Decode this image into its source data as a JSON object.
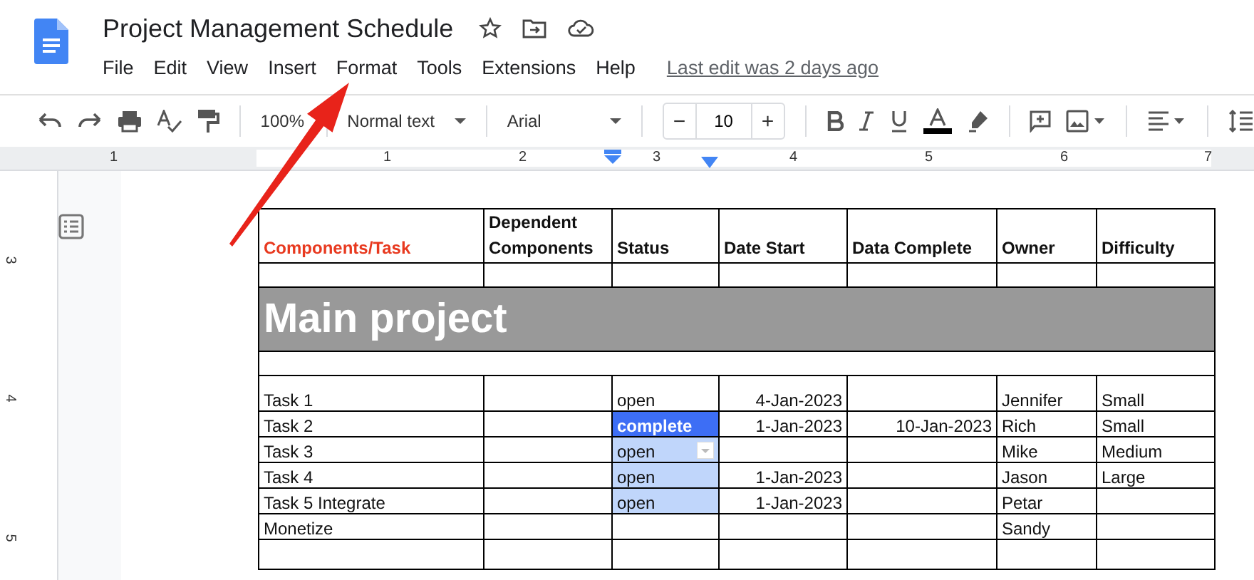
{
  "document": {
    "title": "Project Management Schedule",
    "last_edit": "Last edit was 2 days ago"
  },
  "menu": [
    "File",
    "Edit",
    "View",
    "Insert",
    "Format",
    "Tools",
    "Extensions",
    "Help"
  ],
  "toolbar": {
    "zoom": "100%",
    "style": "Normal text",
    "font": "Arial",
    "font_size": "10",
    "minus": "−",
    "plus": "+"
  },
  "ruler": {
    "top_numbers": [
      "1",
      "1",
      "2",
      "3",
      "4",
      "5",
      "6",
      "7"
    ],
    "side_numbers": [
      "3",
      "4",
      "5"
    ]
  },
  "table": {
    "columns": [
      {
        "label": "Components/Task",
        "accent": true
      },
      {
        "label": "Dependent Components",
        "accent": false
      },
      {
        "label": "Status",
        "accent": false
      },
      {
        "label": "Date Start",
        "accent": false
      },
      {
        "label": "Data Complete",
        "accent": false
      },
      {
        "label": "Owner",
        "accent": false
      },
      {
        "label": "Difficulty",
        "accent": false
      }
    ],
    "banner": "Main project",
    "rows": [
      {
        "task": "Task 1",
        "dependent": "",
        "status": "open",
        "selected": false,
        "highlighted": false,
        "dropdown": false,
        "date_start": "4-Jan-2023",
        "date_complete": "",
        "owner": "Jennifer",
        "difficulty": "Small"
      },
      {
        "task": "Task 2",
        "dependent": "",
        "status": "complete",
        "selected": false,
        "highlighted": true,
        "dropdown": false,
        "date_start": "1-Jan-2023",
        "date_complete": "10-Jan-2023",
        "owner": "Rich",
        "difficulty": "Small"
      },
      {
        "task": "Task 3",
        "dependent": "",
        "status": "open",
        "selected": true,
        "highlighted": false,
        "dropdown": true,
        "date_start": "",
        "date_complete": "",
        "owner": "Mike",
        "difficulty": "Medium"
      },
      {
        "task": "Task 4",
        "dependent": "",
        "status": "open",
        "selected": true,
        "highlighted": false,
        "dropdown": false,
        "date_start": "1-Jan-2023",
        "date_complete": "",
        "owner": "Jason",
        "difficulty": "Large"
      },
      {
        "task": "Task 5 Integrate",
        "dependent": "",
        "status": "open",
        "selected": true,
        "highlighted": false,
        "dropdown": false,
        "date_start": "1-Jan-2023",
        "date_complete": "",
        "owner": "Petar",
        "difficulty": ""
      },
      {
        "task": "Monetize",
        "dependent": "",
        "status": "",
        "selected": false,
        "highlighted": false,
        "dropdown": false,
        "date_start": "",
        "date_complete": "",
        "owner": "Sandy",
        "difficulty": ""
      }
    ]
  }
}
